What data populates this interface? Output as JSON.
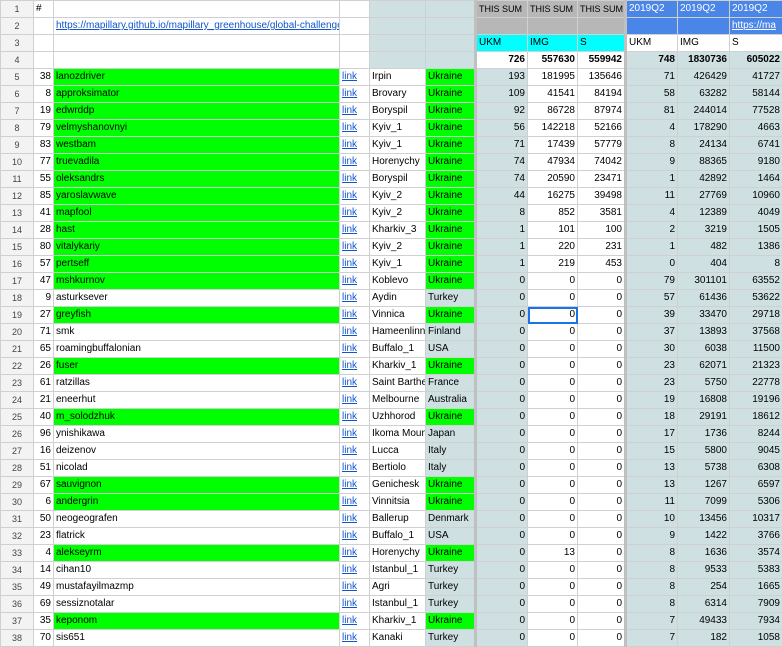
{
  "header": {
    "hash": "#",
    "url": "https://mapillary.github.io/mapillary_greenhouse/global-challenge",
    "url2": "https://ma",
    "this_sum": "THIS SUM",
    "period": "2019Q2",
    "ukm": "UKM",
    "img": "IMG",
    "s": "S",
    "tot_this": [
      "726",
      "557630",
      "559942"
    ],
    "tot_q2": [
      "748",
      "1830736",
      "605022"
    ]
  },
  "rows": [
    {
      "r": "5",
      "n": "38",
      "u": "lanozdriver",
      "c": "Irpin",
      "k": "Ukraine",
      "g": 1,
      "a": [
        "193",
        "181995",
        "135646"
      ],
      "b": [
        "71",
        "426429",
        "41727"
      ]
    },
    {
      "r": "6",
      "n": "8",
      "u": "approksimator",
      "c": "Brovary",
      "k": "Ukraine",
      "g": 1,
      "a": [
        "109",
        "41541",
        "84194"
      ],
      "b": [
        "58",
        "63282",
        "58144"
      ]
    },
    {
      "r": "7",
      "n": "19",
      "u": "edwrddp",
      "c": "Boryspil",
      "k": "Ukraine",
      "g": 1,
      "a": [
        "92",
        "86728",
        "87974"
      ],
      "b": [
        "81",
        "244014",
        "77528"
      ]
    },
    {
      "r": "8",
      "n": "79",
      "u": "velmyshanovnyi",
      "c": "Kyiv_1",
      "k": "Ukraine",
      "g": 1,
      "a": [
        "56",
        "142218",
        "52166"
      ],
      "b": [
        "4",
        "178290",
        "4663"
      ]
    },
    {
      "r": "9",
      "n": "83",
      "u": "westbam",
      "c": "Kyiv_1",
      "k": "Ukraine",
      "g": 1,
      "a": [
        "71",
        "17439",
        "57779"
      ],
      "b": [
        "8",
        "24134",
        "6741"
      ]
    },
    {
      "r": "10",
      "n": "77",
      "u": "truevadila",
      "c": "Horenychy",
      "k": "Ukraine",
      "g": 1,
      "a": [
        "74",
        "47934",
        "74042"
      ],
      "b": [
        "9",
        "88365",
        "9180"
      ]
    },
    {
      "r": "11",
      "n": "55",
      "u": "oleksandrs",
      "c": "Boryspil",
      "k": "Ukraine",
      "g": 1,
      "a": [
        "74",
        "20590",
        "23471"
      ],
      "b": [
        "1",
        "42892",
        "1464"
      ]
    },
    {
      "r": "12",
      "n": "85",
      "u": "yaroslavwave",
      "c": "Kyiv_2",
      "k": "Ukraine",
      "g": 1,
      "a": [
        "44",
        "16275",
        "39498"
      ],
      "b": [
        "11",
        "27769",
        "10960"
      ]
    },
    {
      "r": "13",
      "n": "41",
      "u": "mapfool",
      "c": "Kyiv_2",
      "k": "Ukraine",
      "g": 1,
      "a": [
        "8",
        "852",
        "3581"
      ],
      "b": [
        "4",
        "12389",
        "4049"
      ]
    },
    {
      "r": "14",
      "n": "28",
      "u": "hast",
      "c": "Kharkiv_3",
      "k": "Ukraine",
      "g": 1,
      "a": [
        "1",
        "101",
        "100"
      ],
      "b": [
        "2",
        "3219",
        "1505"
      ]
    },
    {
      "r": "15",
      "n": "80",
      "u": "vitalykariy",
      "c": "Kyiv_2",
      "k": "Ukraine",
      "g": 1,
      "a": [
        "1",
        "220",
        "231"
      ],
      "b": [
        "1",
        "482",
        "1386"
      ]
    },
    {
      "r": "16",
      "n": "57",
      "u": "pertseff",
      "c": "Kyiv_1",
      "k": "Ukraine",
      "g": 1,
      "a": [
        "1",
        "219",
        "453"
      ],
      "b": [
        "0",
        "404",
        "8"
      ]
    },
    {
      "r": "17",
      "n": "47",
      "u": "mshkurnov",
      "c": "Koblevo",
      "k": "Ukraine",
      "g": 1,
      "a": [
        "0",
        "0",
        "0"
      ],
      "b": [
        "79",
        "301101",
        "63552"
      ]
    },
    {
      "r": "18",
      "n": "9",
      "u": "asturksever",
      "c": "Aydin",
      "k": "Turkey",
      "g": 0,
      "a": [
        "0",
        "0",
        "0"
      ],
      "b": [
        "57",
        "61436",
        "53622"
      ]
    },
    {
      "r": "19",
      "n": "27",
      "u": "greyfish",
      "c": "Vinnica",
      "k": "Ukraine",
      "g": 1,
      "a": [
        "0",
        "0",
        "0"
      ],
      "b": [
        "39",
        "33470",
        "29718"
      ]
    },
    {
      "r": "20",
      "n": "71",
      "u": "smk",
      "c": "Hameenlinna",
      "k": "Finland",
      "g": 0,
      "a": [
        "0",
        "0",
        "0"
      ],
      "b": [
        "37",
        "13893",
        "37568"
      ]
    },
    {
      "r": "21",
      "n": "65",
      "u": "roamingbuffalonian",
      "c": "Buffalo_1",
      "k": "USA",
      "g": 0,
      "a": [
        "0",
        "0",
        "0"
      ],
      "b": [
        "30",
        "6038",
        "11500"
      ]
    },
    {
      "r": "22",
      "n": "26",
      "u": "fuser",
      "c": "Kharkiv_1",
      "k": "Ukraine",
      "g": 1,
      "a": [
        "0",
        "0",
        "0"
      ],
      "b": [
        "23",
        "62071",
        "21323"
      ]
    },
    {
      "r": "23",
      "n": "61",
      "u": "ratzillas",
      "c": "Saint Barthe",
      "k": "France",
      "g": 0,
      "a": [
        "0",
        "0",
        "0"
      ],
      "b": [
        "23",
        "5750",
        "22778"
      ]
    },
    {
      "r": "24",
      "n": "21",
      "u": "eneerhut",
      "c": "Melbourne",
      "k": "Australia",
      "g": 0,
      "a": [
        "0",
        "0",
        "0"
      ],
      "b": [
        "19",
        "16808",
        "19196"
      ]
    },
    {
      "r": "25",
      "n": "40",
      "u": "m_solodzhuk",
      "c": "Uzhhorod",
      "k": "Ukraine",
      "g": 1,
      "a": [
        "0",
        "0",
        "0"
      ],
      "b": [
        "18",
        "29191",
        "18612"
      ]
    },
    {
      "r": "26",
      "n": "96",
      "u": "ynishikawa",
      "c": "Ikoma Moun",
      "k": "Japan",
      "g": 0,
      "a": [
        "0",
        "0",
        "0"
      ],
      "b": [
        "17",
        "1736",
        "8244"
      ]
    },
    {
      "r": "27",
      "n": "16",
      "u": "deizenov",
      "c": "Lucca",
      "k": "Italy",
      "g": 0,
      "a": [
        "0",
        "0",
        "0"
      ],
      "b": [
        "15",
        "5800",
        "9045"
      ]
    },
    {
      "r": "28",
      "n": "51",
      "u": "nicolad",
      "c": "Bertiolo",
      "k": "Italy",
      "g": 0,
      "a": [
        "0",
        "0",
        "0"
      ],
      "b": [
        "13",
        "5738",
        "6308"
      ]
    },
    {
      "r": "29",
      "n": "67",
      "u": "sauvignon",
      "c": "Genichesk",
      "k": "Ukraine",
      "g": 1,
      "a": [
        "0",
        "0",
        "0"
      ],
      "b": [
        "13",
        "1267",
        "6597"
      ]
    },
    {
      "r": "30",
      "n": "6",
      "u": "andergrin",
      "c": "Vinnitsia",
      "k": "Ukraine",
      "g": 1,
      "a": [
        "0",
        "0",
        "0"
      ],
      "b": [
        "11",
        "7099",
        "5306"
      ]
    },
    {
      "r": "31",
      "n": "50",
      "u": "neogeografen",
      "c": "Ballerup",
      "k": "Denmark",
      "g": 0,
      "a": [
        "0",
        "0",
        "0"
      ],
      "b": [
        "10",
        "13456",
        "10317"
      ]
    },
    {
      "r": "32",
      "n": "23",
      "u": "flatrick",
      "c": "Buffalo_1",
      "k": "USA",
      "g": 0,
      "a": [
        "0",
        "0",
        "0"
      ],
      "b": [
        "9",
        "1422",
        "3766"
      ]
    },
    {
      "r": "33",
      "n": "4",
      "u": "alekseyrm",
      "c": "Horenychy",
      "k": "Ukraine",
      "g": 1,
      "a": [
        "0",
        "13",
        "0"
      ],
      "b": [
        "8",
        "1636",
        "3574"
      ]
    },
    {
      "r": "34",
      "n": "14",
      "u": "cihan10",
      "c": "Istanbul_1",
      "k": "Turkey",
      "g": 0,
      "a": [
        "0",
        "0",
        "0"
      ],
      "b": [
        "8",
        "9533",
        "5383"
      ]
    },
    {
      "r": "35",
      "n": "49",
      "u": "mustafayilmazmp",
      "c": "Agri",
      "k": "Turkey",
      "g": 0,
      "a": [
        "0",
        "0",
        "0"
      ],
      "b": [
        "8",
        "254",
        "1665"
      ]
    },
    {
      "r": "36",
      "n": "69",
      "u": "sessiznotalar",
      "c": "Istanbul_1",
      "k": "Turkey",
      "g": 0,
      "a": [
        "0",
        "0",
        "0"
      ],
      "b": [
        "8",
        "6314",
        "7909"
      ]
    },
    {
      "r": "37",
      "n": "35",
      "u": "keponom",
      "c": "Kharkiv_1",
      "k": "Ukraine",
      "g": 1,
      "a": [
        "0",
        "0",
        "0"
      ],
      "b": [
        "7",
        "49433",
        "7934"
      ]
    },
    {
      "r": "38",
      "n": "70",
      "u": "sis651",
      "c": "Kanaki",
      "k": "Turkey",
      "g": 0,
      "a": [
        "0",
        "0",
        "0"
      ],
      "b": [
        "7",
        "182",
        "1058"
      ]
    }
  ],
  "link_text": "link",
  "colors": {
    "green": "#00ff00",
    "gray": "#cfe0e3",
    "header_gray": "#b7b7b7",
    "header_blue": "#4a86e8",
    "cyan": "#00ffff",
    "link": "#1155cc"
  }
}
